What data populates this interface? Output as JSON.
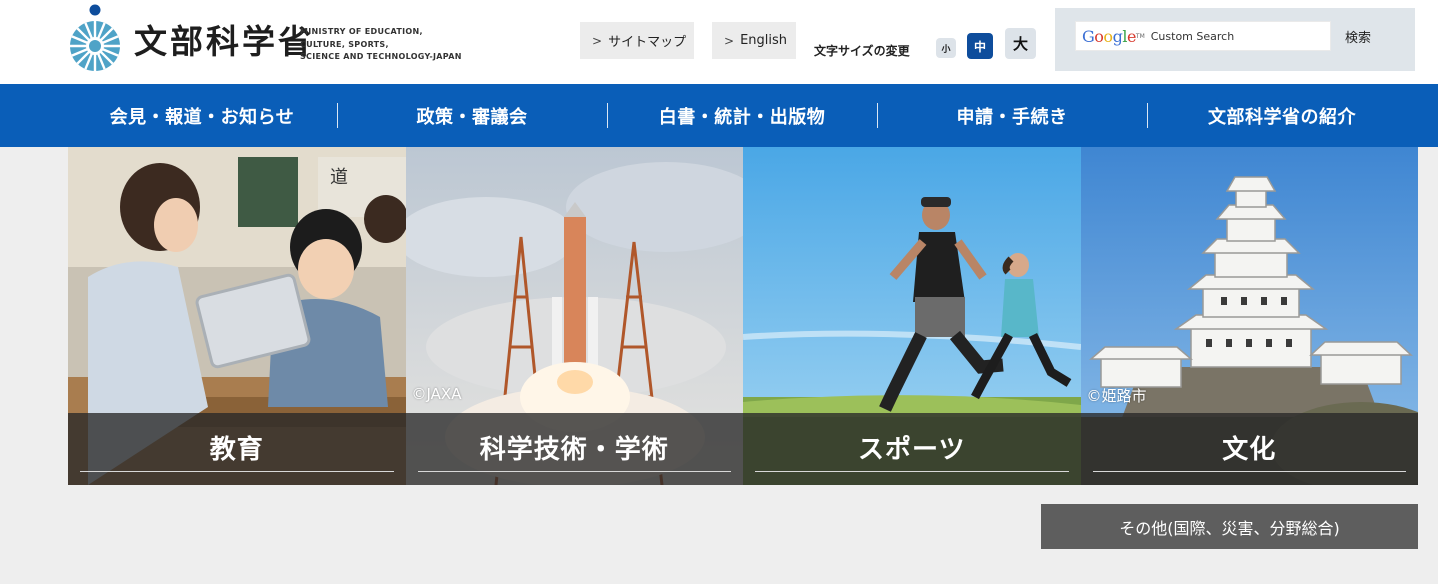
{
  "header": {
    "logo_jp": "文部科学省",
    "logo_en_lines": [
      "MINISTRY OF EDUCATION,",
      "CULTURE, SPORTS,",
      "SCIENCE AND TECHNOLOGY-JAPAN"
    ],
    "sitemap_label": "サイトマップ",
    "english_label": "English",
    "fontsize": {
      "label": "文字サイズの変更",
      "small": "小",
      "medium": "中",
      "large": "大",
      "selected": "中"
    },
    "search": {
      "brand": "Google",
      "brand_tm": "TM",
      "placeholder": "Custom Search",
      "submit_label": "検索"
    }
  },
  "nav": {
    "items": [
      {
        "label": "会見・報道・お知らせ"
      },
      {
        "label": "政策・審議会"
      },
      {
        "label": "白書・統計・出版物"
      },
      {
        "label": "申請・手続き"
      },
      {
        "label": "文部科学省の紹介"
      }
    ]
  },
  "tiles": [
    {
      "label": "教育",
      "credit": ""
    },
    {
      "label": "科学技術・学術",
      "credit": "©JAXA"
    },
    {
      "label": "スポーツ",
      "credit": ""
    },
    {
      "label": "文化",
      "credit": "©姫路市"
    }
  ],
  "other": {
    "label": "その他(国際、災害、分野総合)"
  },
  "colors": {
    "nav_bg": "#0a5eb8",
    "accent_dark": "#0e4d9c",
    "caption_bg": "#282828",
    "page_bg": "#eeeeee"
  },
  "icons": {
    "chevron": "chevron-right-icon",
    "logo": "mext-logo-icon"
  }
}
